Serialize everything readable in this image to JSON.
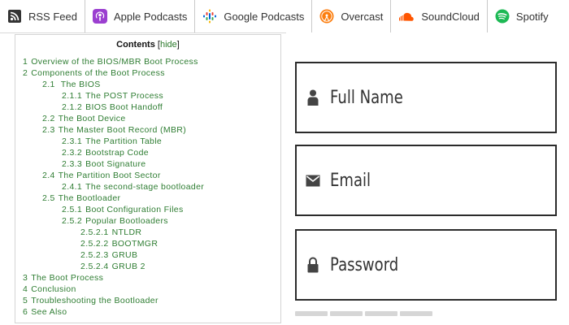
{
  "podcast_bar": {
    "items": [
      {
        "label": "RSS Feed",
        "icon": "rss-icon",
        "color": "#333333"
      },
      {
        "label": "Apple Podcasts",
        "icon": "apple-podcasts-icon",
        "color": "#9933cc"
      },
      {
        "label": "Google Podcasts",
        "icon": "google-podcasts-icon",
        "color": "#4285f4"
      },
      {
        "label": "Overcast",
        "icon": "overcast-icon",
        "color": "#fc7e0f"
      },
      {
        "label": "SoundCloud",
        "icon": "soundcloud-icon",
        "color": "#ff5500"
      },
      {
        "label": "Spotify",
        "icon": "spotify-icon",
        "color": "#1db954"
      }
    ]
  },
  "toc": {
    "title": "Contents",
    "hide_label": "hide",
    "link_color": "#2e7d32",
    "items": [
      {
        "num": "1",
        "text": "Overview of the BIOS/MBR Boot Process",
        "level": 1
      },
      {
        "num": "2",
        "text": "Components of the Boot Process",
        "level": 1
      },
      {
        "num": "2.1",
        "text": " The BIOS",
        "level": 2
      },
      {
        "num": "2.1.1",
        "text": "The POST Process",
        "level": 3
      },
      {
        "num": "2.1.2",
        "text": "BIOS Boot Handoff",
        "level": 3
      },
      {
        "num": "2.2",
        "text": "The Boot Device",
        "level": 2
      },
      {
        "num": "2.3",
        "text": "The Master Boot Record (MBR)",
        "level": 2
      },
      {
        "num": "2.3.1",
        "text": "The Partition Table",
        "level": 3
      },
      {
        "num": "2.3.2",
        "text": "Bootstrap Code",
        "level": 3
      },
      {
        "num": "2.3.3",
        "text": "Boot Signature",
        "level": 3
      },
      {
        "num": "2.4",
        "text": "The Partition Boot Sector",
        "level": 2
      },
      {
        "num": "2.4.1",
        "text": "The second-stage bootloader",
        "level": 3
      },
      {
        "num": "2.5",
        "text": "The Bootloader",
        "level": 2
      },
      {
        "num": "2.5.1",
        "text": "Boot Configuration Files",
        "level": 3
      },
      {
        "num": "2.5.2",
        "text": "Popular Bootloaders",
        "level": 3
      },
      {
        "num": "2.5.2.1",
        "text": "NTLDR",
        "level": 4
      },
      {
        "num": "2.5.2.2",
        "text": "BOOTMGR",
        "level": 4
      },
      {
        "num": "2.5.2.3",
        "text": "GRUB",
        "level": 4
      },
      {
        "num": "2.5.2.4",
        "text": "GRUB 2",
        "level": 4
      },
      {
        "num": "3",
        "text": "The Boot Process",
        "level": 1
      },
      {
        "num": "4",
        "text": "Conclusion",
        "level": 1
      },
      {
        "num": "5",
        "text": "Troubleshooting the Bootloader",
        "level": 1
      },
      {
        "num": "6",
        "text": "See Also",
        "level": 1
      }
    ]
  },
  "login_form": {
    "full_name": {
      "placeholder": "Full Name",
      "icon": "user-icon"
    },
    "email": {
      "placeholder": "Email",
      "icon": "envelope-icon"
    },
    "password": {
      "placeholder": "Password",
      "icon": "lock-icon"
    }
  }
}
